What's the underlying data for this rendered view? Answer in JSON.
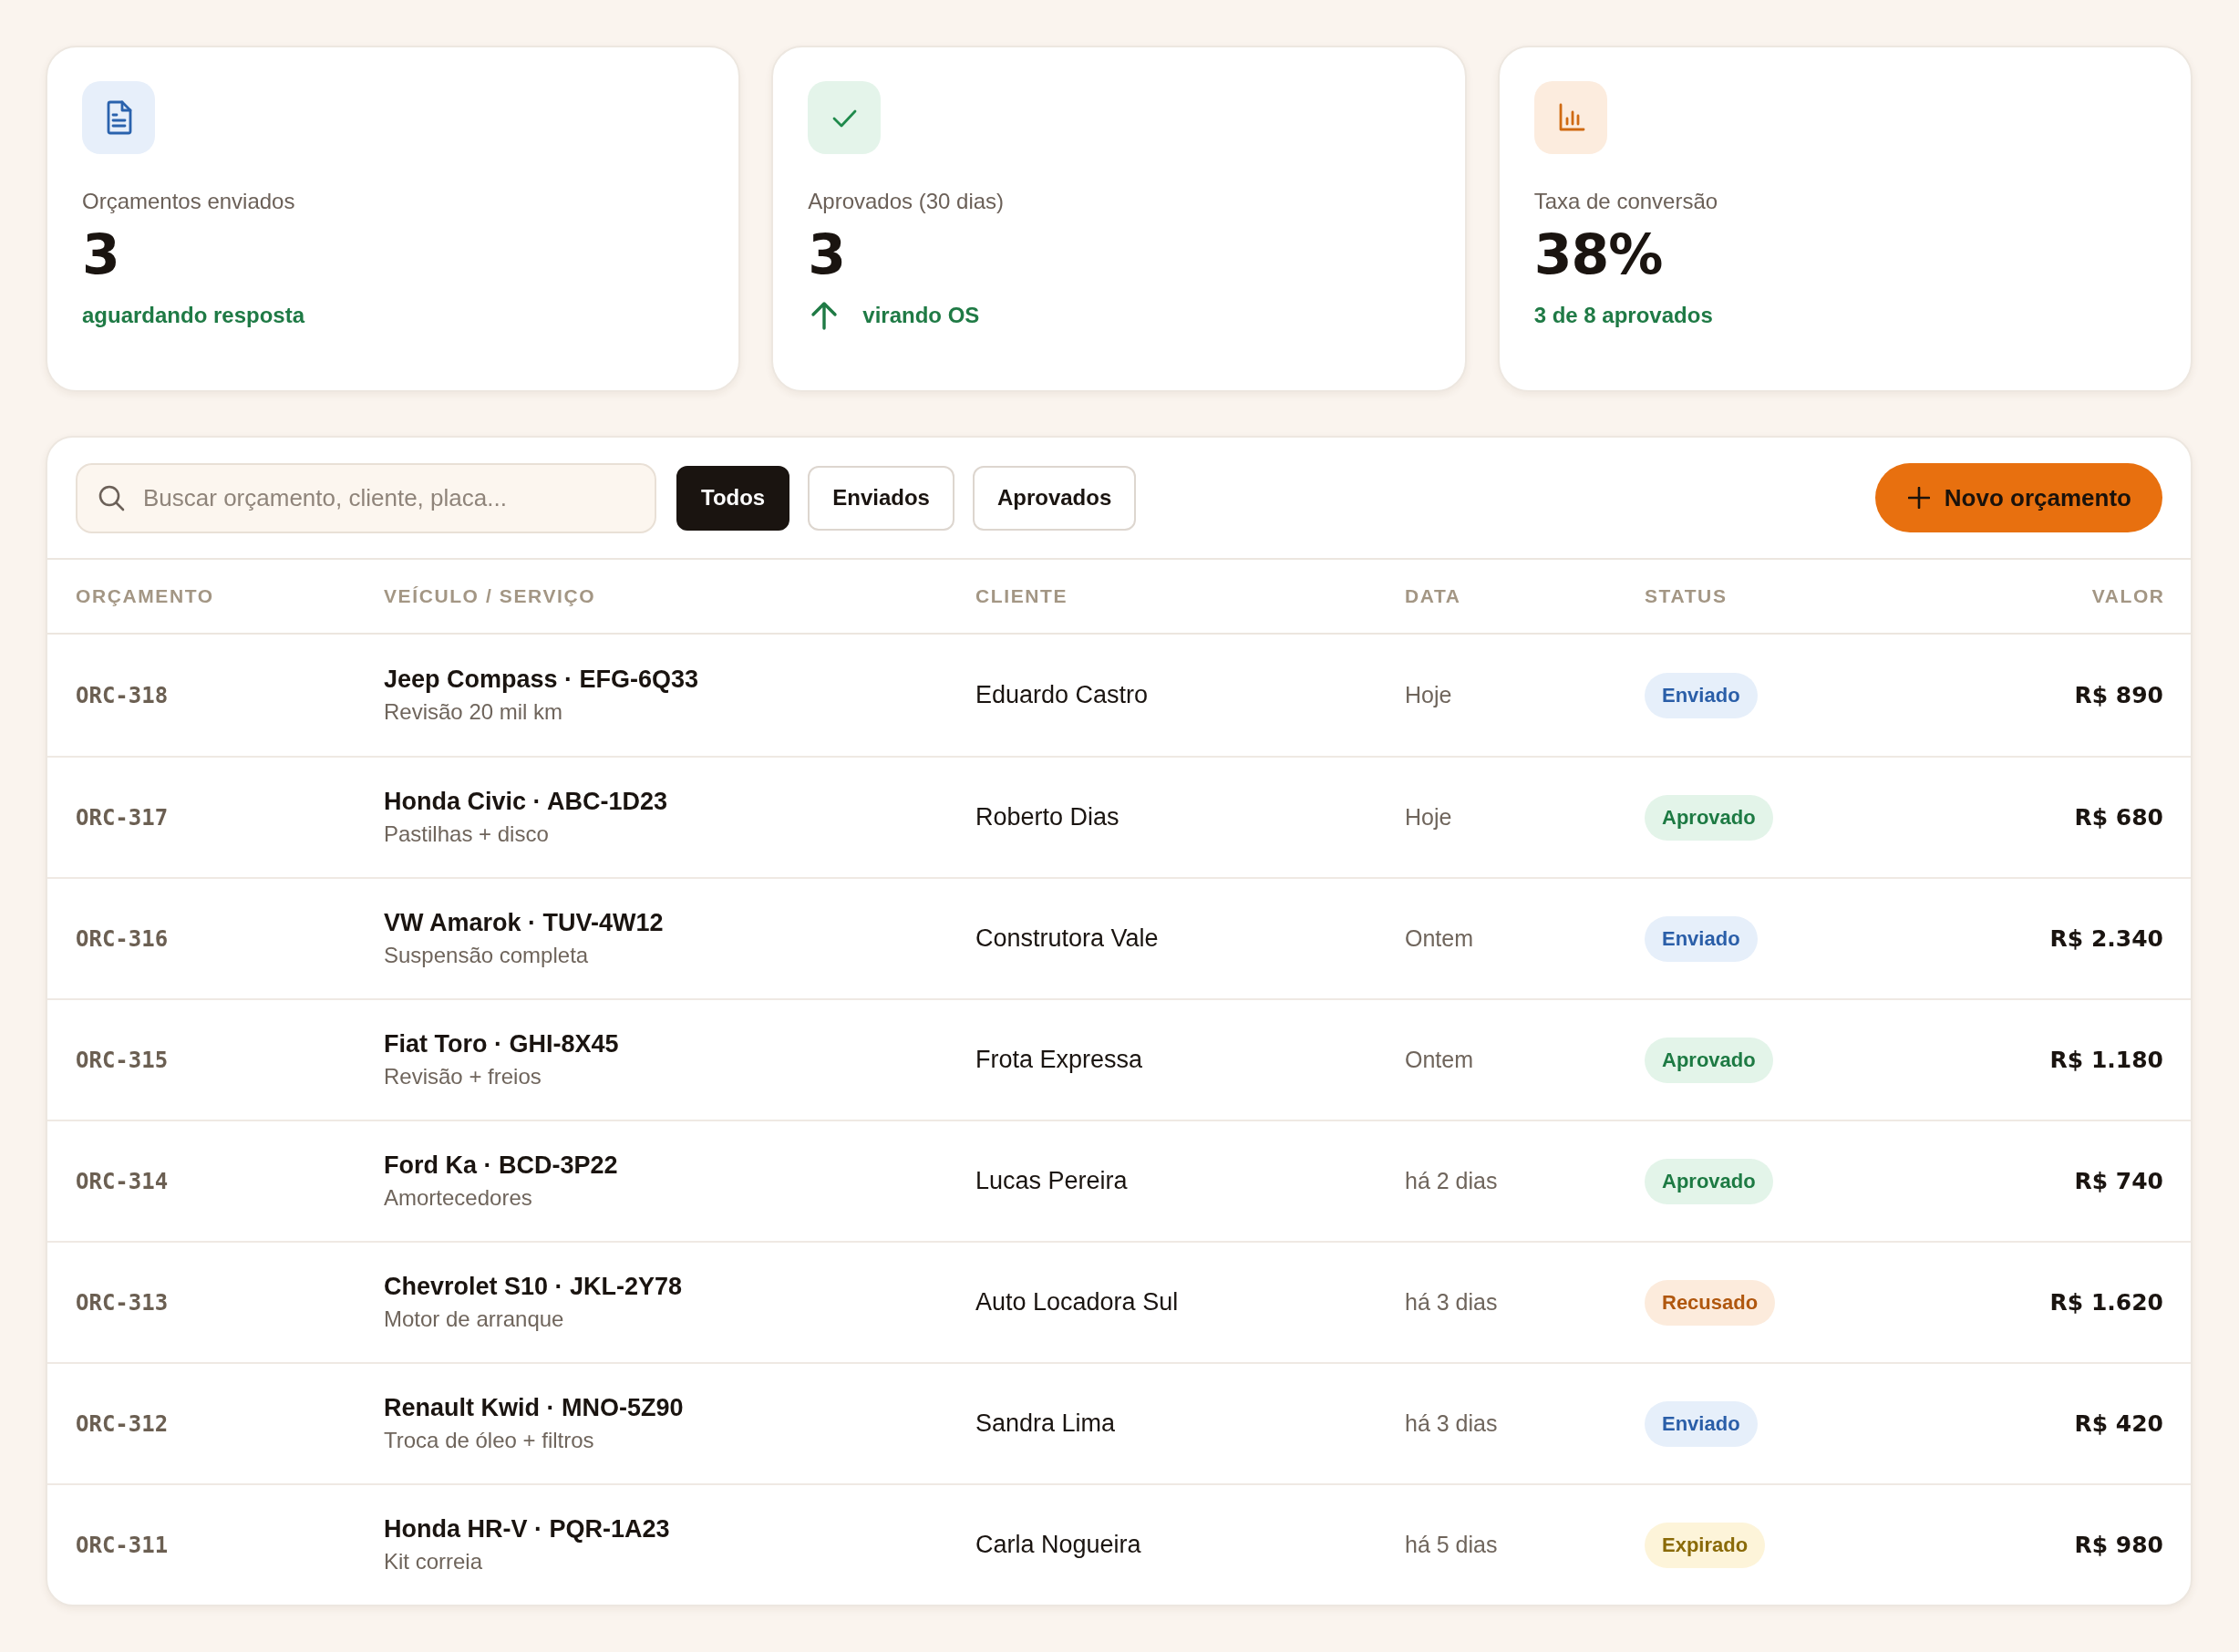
{
  "stats": [
    {
      "kind": "sent",
      "label": "Orçamentos enviados",
      "value": "3",
      "note": "aguardando resposta",
      "trend_up": false
    },
    {
      "kind": "approved",
      "label": "Aprovados (30 dias)",
      "value": "3",
      "note": "virando OS",
      "trend_up": true
    },
    {
      "kind": "conversion",
      "label": "Taxa de conversão",
      "value": "38%",
      "note": "3 de 8 aprovados",
      "trend_up": false
    }
  ],
  "toolbar": {
    "search": {
      "placeholder": "Buscar orçamento, cliente, placa..."
    },
    "filters": [
      {
        "label": "Todos",
        "selected": true
      },
      {
        "label": "Enviados",
        "selected": false
      },
      {
        "label": "Aprovados",
        "selected": false
      }
    ],
    "new_button": {
      "label": "Novo orçamento"
    }
  },
  "table": {
    "columns": [
      "ORÇAMENTO",
      "VEÍCULO / SERVIÇO",
      "CLIENTE",
      "DATA",
      "STATUS",
      "VALOR"
    ],
    "rows": [
      {
        "id": "ORC-318",
        "vehicle": "Jeep Compass · EFG-6Q33",
        "service": "Revisão 20 mil km",
        "client": "Eduardo Castro",
        "date": "Hoje",
        "status": {
          "label": "Enviado",
          "kind": "sent"
        },
        "value": "R$ 890"
      },
      {
        "id": "ORC-317",
        "vehicle": "Honda Civic · ABC-1D23",
        "service": "Pastilhas + disco",
        "client": "Roberto Dias",
        "date": "Hoje",
        "status": {
          "label": "Aprovado",
          "kind": "approved"
        },
        "value": "R$ 680"
      },
      {
        "id": "ORC-316",
        "vehicle": "VW Amarok · TUV-4W12",
        "service": "Suspensão completa",
        "client": "Construtora Vale",
        "date": "Ontem",
        "status": {
          "label": "Enviado",
          "kind": "sent"
        },
        "value": "R$ 2.340"
      },
      {
        "id": "ORC-315",
        "vehicle": "Fiat Toro · GHI-8X45",
        "service": "Revisão + freios",
        "client": "Frota Expressa",
        "date": "Ontem",
        "status": {
          "label": "Aprovado",
          "kind": "approved"
        },
        "value": "R$ 1.180"
      },
      {
        "id": "ORC-314",
        "vehicle": "Ford Ka · BCD-3P22",
        "service": "Amortecedores",
        "client": "Lucas Pereira",
        "date": "há 2 dias",
        "status": {
          "label": "Aprovado",
          "kind": "approved"
        },
        "value": "R$ 740"
      },
      {
        "id": "ORC-313",
        "vehicle": "Chevrolet S10 · JKL-2Y78",
        "service": "Motor de arranque",
        "client": "Auto Locadora Sul",
        "date": "há 3 dias",
        "status": {
          "label": "Recusado",
          "kind": "refused"
        },
        "value": "R$ 1.620"
      },
      {
        "id": "ORC-312",
        "vehicle": "Renault Kwid · MNO-5Z90",
        "service": "Troca de óleo + filtros",
        "client": "Sandra Lima",
        "date": "há 3 dias",
        "status": {
          "label": "Enviado",
          "kind": "sent"
        },
        "value": "R$ 420"
      },
      {
        "id": "ORC-311",
        "vehicle": "Honda HR-V · PQR-1A23",
        "service": "Kit correia",
        "client": "Carla Nogueira",
        "date": "há 5 dias",
        "status": {
          "label": "Expirado",
          "kind": "expired"
        },
        "value": "R$ 980"
      }
    ]
  }
}
